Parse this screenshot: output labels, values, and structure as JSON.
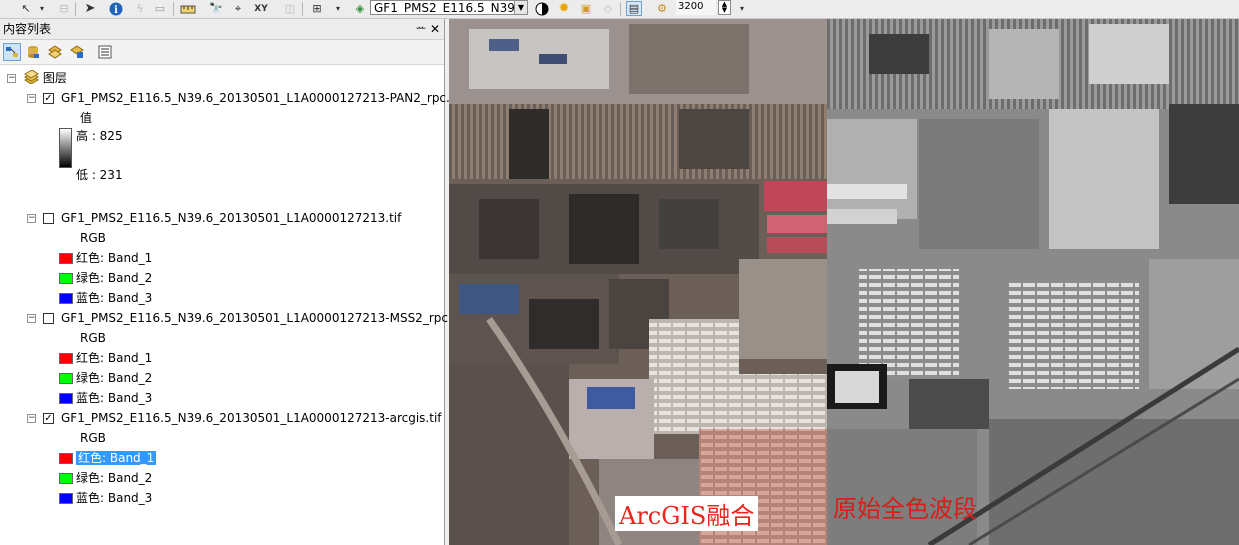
{
  "toolbar": {
    "layer_selector": "GF1_PMS2_E116.5_N39.6",
    "zoom_value": "3200",
    "icons": [
      "select-arrow-icon",
      "identify-icon",
      "lightning-icon",
      "html-popup-icon",
      "measure-icon",
      "find-icon",
      "goto-xy-icon",
      "xy-icon",
      "zoom-icon",
      "contrast-icon",
      "brightness-icon",
      "effects-icon",
      "swipe-icon",
      "layer-transparency-icon"
    ]
  },
  "toc": {
    "title": "内容列表",
    "pin": "ᅭ",
    "close": "✕",
    "root_label": "图层",
    "layers": [
      {
        "name": "GF1_PMS2_E116.5_N39.6_20130501_L1A0000127213-PAN2_rpc.tif",
        "checked": true,
        "legend_heading": "值",
        "high": "高 : 825",
        "low": "低 : 231"
      },
      {
        "name": "GF1_PMS2_E116.5_N39.6_20130501_L1A0000127213.tif",
        "checked": false,
        "legend_heading": "RGB",
        "bands": [
          {
            "label": "红色:    Band_1",
            "color": "#ff0000"
          },
          {
            "label": "绿色: Band_2",
            "color": "#00ff00"
          },
          {
            "label": "蓝色:    Band_3",
            "color": "#0000ff"
          }
        ]
      },
      {
        "name": "GF1_PMS2_E116.5_N39.6_20130501_L1A0000127213-MSS2_rpc.tiff",
        "checked": false,
        "legend_heading": "RGB",
        "bands": [
          {
            "label": "红色:    Band_1",
            "color": "#ff0000"
          },
          {
            "label": "绿色: Band_2",
            "color": "#00ff00"
          },
          {
            "label": "蓝色:    Band_3",
            "color": "#0000ff"
          }
        ]
      },
      {
        "name": "GF1_PMS2_E116.5_N39.6_20130501_L1A0000127213-arcgis.tif",
        "checked": true,
        "legend_heading": "RGB",
        "bands": [
          {
            "label": "红色:    Band_1",
            "color": "#ff0000"
          },
          {
            "label": "绿色: Band_2",
            "color": "#00ff00"
          },
          {
            "label": "蓝色:    Band_3",
            "color": "#0000ff"
          }
        ]
      }
    ]
  },
  "map": {
    "left_label": "ArcGIS融合",
    "right_label": "原始全色波段"
  }
}
